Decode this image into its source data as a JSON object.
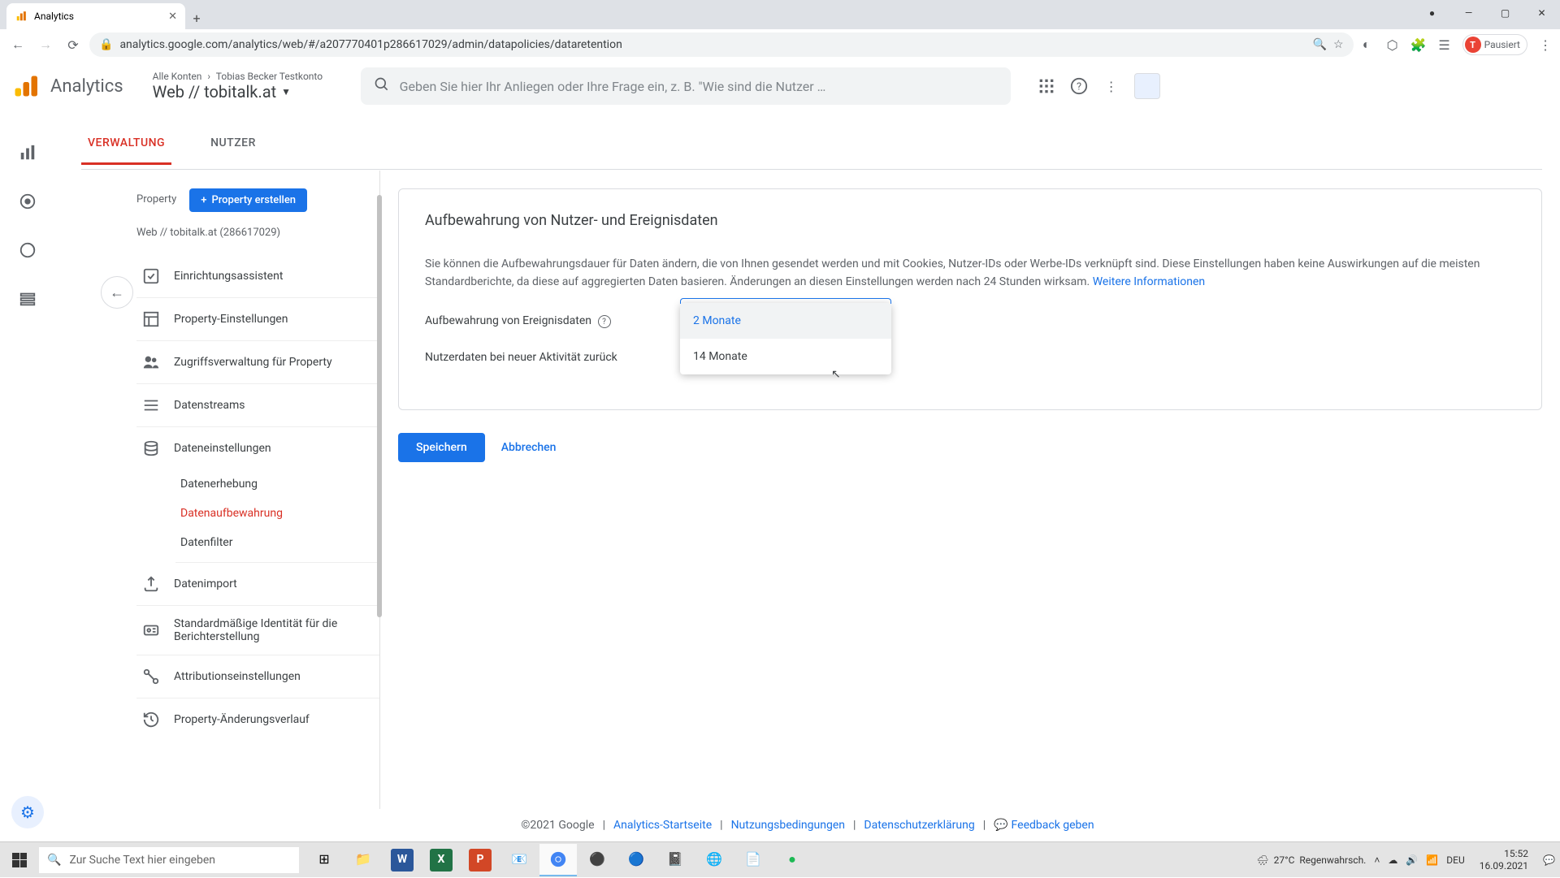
{
  "browser": {
    "tab_title": "Analytics",
    "url": "analytics.google.com/analytics/web/#/a207770401p286617029/admin/datapolicies/dataretention",
    "profile_label": "Pausiert",
    "profile_initial": "T"
  },
  "ga_header": {
    "title": "Analytics",
    "crumb_all": "Alle Konten",
    "crumb_account": "Tobias Becker Testkonto",
    "property": "Web // tobitalk.at",
    "search_placeholder": "Geben Sie hier Ihr Anliegen oder Ihre Frage ein, z. B. \"Wie sind die Nutzer …"
  },
  "tabs": {
    "admin": "VERWALTUNG",
    "users": "NUTZER"
  },
  "sidebar": {
    "property_label": "Property",
    "create_btn": "Property erstellen",
    "property_id": "Web // tobitalk.at (286617029)",
    "items": {
      "setup": "Einrichtungsassistent",
      "settings": "Property-Einstellungen",
      "access": "Zugriffsverwaltung für Property",
      "streams": "Datenstreams",
      "data_settings": "Dateneinstellungen",
      "collection": "Datenerhebung",
      "retention": "Datenaufbewahrung",
      "filter": "Datenfilter",
      "import": "Datenimport",
      "identity": "Standardmäßige Identität für die Berichterstellung",
      "attribution": "Attributionseinstellungen",
      "history": "Property-Änderungsverlauf"
    }
  },
  "main": {
    "title": "Aufbewahrung von Nutzer- und Ereignisdaten",
    "desc": "Sie können die Aufbewahrungsdauer für Daten ändern, die von Ihnen gesendet werden und mit Cookies, Nutzer-IDs oder Werbe-IDs verknüpft sind. Diese Einstellungen haben keine Auswirkungen auf die meisten Standardberichte, da diese auf aggregierten Daten basieren. Änderungen an diesen Einstellungen werden nach 24 Stunden wirksam.",
    "more_info": "Weitere Informationen",
    "row1_label": "Aufbewahrung von Ereignisdaten",
    "row2_label": "Nutzerdaten bei neuer Aktivität zurück",
    "dropdown": {
      "opt1": "2 Monate",
      "opt2": "14 Monate"
    },
    "save": "Speichern",
    "cancel": "Abbrechen"
  },
  "footer": {
    "copyright": "©2021 Google",
    "home": "Analytics-Startseite",
    "terms": "Nutzungsbedingungen",
    "privacy": "Datenschutzerklärung",
    "feedback": "Feedback geben"
  },
  "taskbar": {
    "search_placeholder": "Zur Suche Text hier eingeben",
    "weather_temp": "27°C",
    "weather_desc": "Regenwahrsch.",
    "lang": "DEU",
    "time": "15:52",
    "date": "16.09.2021"
  }
}
